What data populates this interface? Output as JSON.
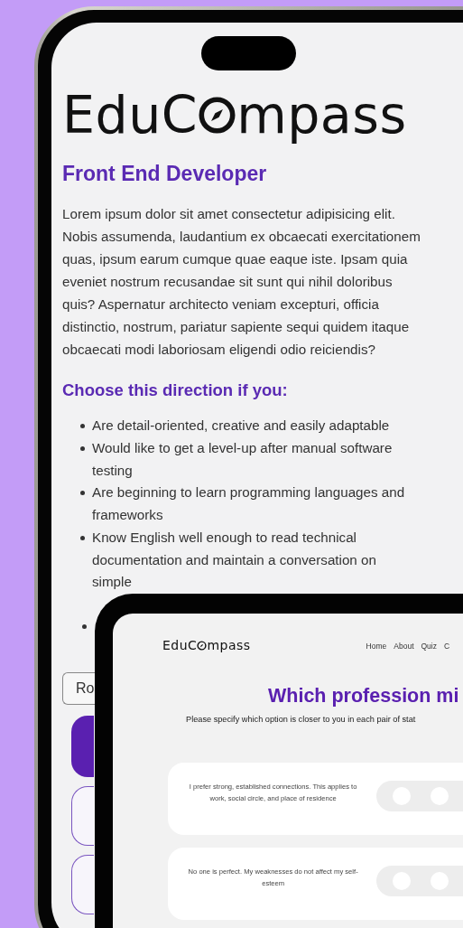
{
  "phone": {
    "logo": {
      "before": "EduC",
      "after": "mpass"
    },
    "title": "Front End Developer",
    "description": "Lorem ipsum dolor sit amet consectetur adipisicing elit. Nobis assumenda, laudantium ex obcaecati exercitationem quas, ipsum earum cumque quae eaque iste. Ipsam quia eveniet nostrum recusandae sit sunt qui nihil doloribus quis? Aspernatur architecto veniam excepturi, officia distinctio, nostrum, pariatur sapiente sequi quidem itaque obcaecati modi laboriosam eligendi odio reiciendis?",
    "subtitle": "Choose this direction if you:",
    "bullets": [
      "Are detail-oriented, creative and easily adaptable",
      "Would like to get a level-up after manual software testing",
      "Are beginning to learn programming languages and frameworks",
      "Know English well enough to read technical documentation and maintain a conversation on simple"
    ],
    "roadmap_button": "Ro"
  },
  "tablet": {
    "logo": {
      "before": "EduC",
      "after": "mpass"
    },
    "nav": [
      "Home",
      "About",
      "Quiz",
      "C"
    ],
    "title": "Which profession mi",
    "subtitle": "Please specify which option is closer to you in each pair of stat",
    "statements": [
      "I prefer strong, established connections. This applies to work, social circle, and place of residence",
      "No one is perfect. My weaknesses do not affect my self-esteem"
    ]
  }
}
